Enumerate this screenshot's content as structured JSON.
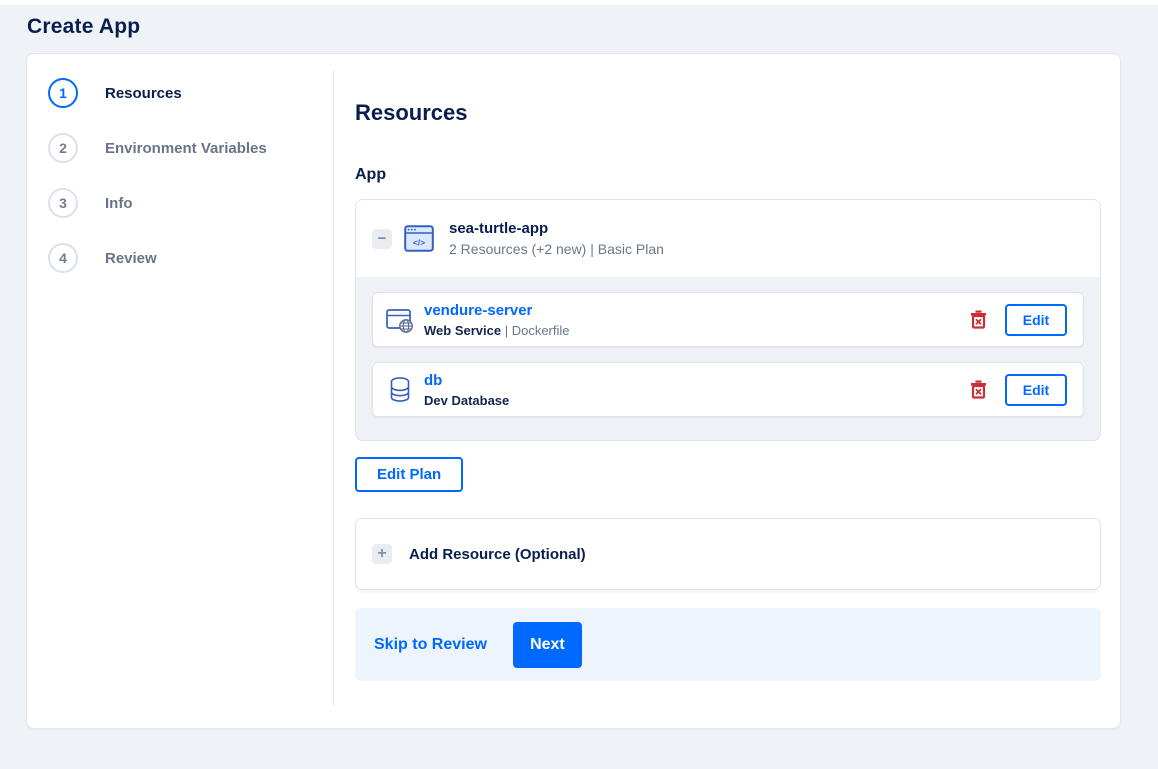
{
  "page": {
    "title": "Create App"
  },
  "stepper": {
    "active_step": 1,
    "steps": [
      {
        "number": "1",
        "label": "Resources"
      },
      {
        "number": "2",
        "label": "Environment Variables"
      },
      {
        "number": "3",
        "label": "Info"
      },
      {
        "number": "4",
        "label": "Review"
      }
    ]
  },
  "main": {
    "heading": "Resources",
    "section_label": "App",
    "app_group": {
      "collapse_glyph": "−",
      "name": "sea-turtle-app",
      "summary": "2 Resources (+2 new) | Basic Plan",
      "resources": [
        {
          "name": "vendure-server",
          "type": "Web Service",
          "detail": " | Dockerfile",
          "icon": "web-service-icon",
          "edit_label": "Edit"
        },
        {
          "name": "db",
          "type": "Dev Database",
          "detail": "",
          "icon": "database-icon",
          "edit_label": "Edit"
        }
      ]
    },
    "edit_plan_label": "Edit Plan",
    "add_resource": {
      "plus_glyph": "+",
      "label": "Add Resource (Optional)"
    },
    "footer": {
      "skip_label": "Skip to Review",
      "next_label": "Next"
    }
  },
  "colors": {
    "accent": "#0069ff",
    "navy": "#031b4e",
    "danger": "#cc2d36",
    "icon_blue": "#3560c0",
    "footer_bg": "#edf4fb"
  }
}
